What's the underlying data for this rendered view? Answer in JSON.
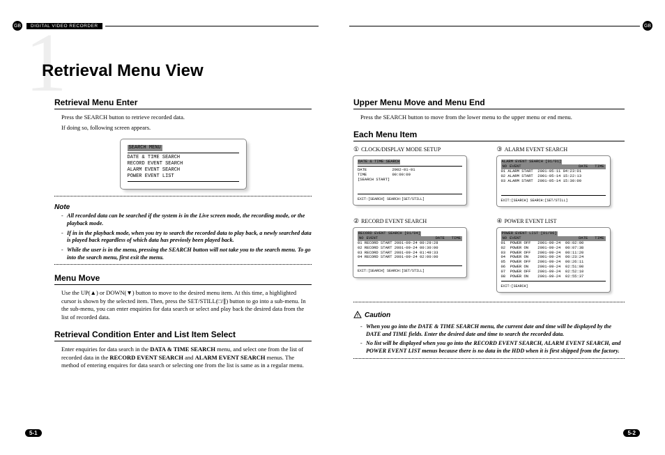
{
  "header": {
    "gb": "GB",
    "dvr": "DIGITAL VIDEO RECORDER"
  },
  "page_title": "Retrieval Menu View",
  "big_one": "1",
  "left": {
    "sec1": {
      "heading": "Retrieval Menu Enter",
      "p1": "Press the SEARCH button to retrieve recorded data.",
      "p2": "If doing so, following screen appears.",
      "screen": {
        "title": "SEARCH MENU",
        "items": [
          "DATE & TIME SEARCH",
          "RECORD EVENT SEARCH",
          "ALARM EVENT SEARCH",
          "POWER EVENT LIST"
        ]
      },
      "note_label": "Note",
      "notes": [
        "All recorded data can be searched if the system is in the Live screen mode, the recording mode, or the playback mode.",
        "If in in the playback mode, when you try to search the recorded data to play back, a newly searched data is played back regardless of which data has previosly been played back.",
        "While the user is in the menu, pressing the SEARCH button will not take you to the search menu. To go into the search menu, first exit the menu."
      ]
    },
    "sec2": {
      "heading": "Menu Move",
      "p1": "Use the UP(▲) or DOWN(▼) button to move to the desired menu item. At this time, a highlighted cursor is shown by the selected item. Then, press the SET/STILL(□/∥) button to go into a sub-menu. In the sub-menu, you can enter enquiries for data search or select and play back the desired data from the list of recorded data."
    },
    "sec3": {
      "heading": "Retrieval Condition Enter and List Item Select",
      "p1a": "Enter enquiries for data search in the ",
      "p1b": "DATA & TIME SEARCH",
      "p1c": " menu, and select one from the list of recorded data in the ",
      "p1d": "RECORD EVENT SEARCH",
      "p1e": " and ",
      "p1f": "ALARM EVENT SEARCH",
      "p1g": " menus. The method of entering enquires for data search or selecting one from the list is same as in a regular menu."
    },
    "page_no": "5-1"
  },
  "right": {
    "sec1": {
      "heading": "Upper Menu Move and Menu End",
      "p1": "Press the SEARCH button to move from the lower menu to the upper menu or end menu."
    },
    "sec2": {
      "heading": "Each Menu Item",
      "items": [
        {
          "num": "①",
          "label": "CLOCK/DISPLAY MODE SETUP",
          "screen": {
            "title": "DATE & TIME SEARCH",
            "rows": [
              "DATE           2002-01-01",
              "TIME           00:00:00",
              "[SEARCH START]"
            ],
            "footer": "EXIT:[SEARCH] SEARCH:[SET/STILL]"
          }
        },
        {
          "num": "③",
          "label": "ALARM EVENT SEARCH",
          "screen": {
            "title": "ALARM EVENT SEARCH        [01/01]",
            "head": [
              "NO",
              "EVENT",
              "DATE",
              "TIME"
            ],
            "rows": [
              "01 ALARM START  2001-05-11 04:23:01",
              "02 ALARM START  2001-05-14 15:22:13",
              "03 ALARM START  2001-05-14 15:30:00"
            ],
            "footer": "EXIT:[SEARCH] SEARCH:[SET/STILL]"
          }
        },
        {
          "num": "②",
          "label": "RECORD EVENT SEARCH",
          "screen": {
            "title": "RECORD EVENT SEARCH       [01/04]",
            "head": [
              "NO",
              "EVENT",
              "DATE",
              "TIME"
            ],
            "rows": [
              "01 RECORD START 2001-09-24 00:29:28",
              "02 RECORD START 2001-09-24 00:30:00",
              "03 RECORD START 2001-09-24 01:49:33",
              "04 RECORD START 2001-09-24 02:00:00"
            ],
            "footer": "EXIT:[SEARCH] SEARCH:[SET/STILL]"
          }
        },
        {
          "num": "④",
          "label": "POWER EVENT LIST",
          "screen": {
            "title": "POWER EVENT LIST          [01/06]",
            "head": [
              "NO",
              "EVENT",
              "DATE",
              "TIME"
            ],
            "rows": [
              "01  POWER OFF   2001-09-24  00:02:00",
              "02  POWER ON    2001-09-24  00:07:38",
              "03  POWER OFF   2001-09-24  00:11:20",
              "04  POWER ON    2001-09-24  00:23:24",
              "05  POWER OFF   2001-09-24  00:26:11",
              "06  POWER ON    2001-09-24  02:51:00",
              "07  POWER OFF   2001-09-24  02:52:10",
              "08  POWER ON    2001-09-24  02:55:37"
            ],
            "footer": "EXIT:[SEARCH]"
          }
        }
      ]
    },
    "caution_label": "Caution",
    "cautions": [
      "When you go into the DATE & TIME SEARCH menu, the current date and time will be displayed by the DATE and TIME fields. Enter the desired date and time to search the recorded data.",
      "No list will be displayed when you go into the RECORD EVENT SEARCH, ALARM EVENT SEARCH, and POWER EVENT LIST menus because there is no data in the HDD when it is first shipped from the factory."
    ],
    "page_no": "5-2"
  }
}
